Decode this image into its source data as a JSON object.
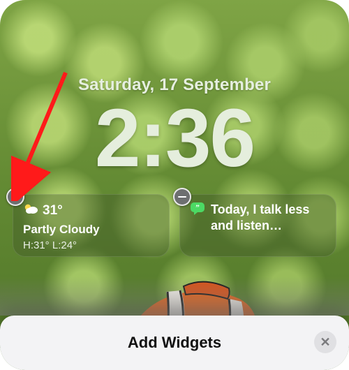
{
  "lockscreen": {
    "date": "Saturday, 17 September",
    "time": "2:36"
  },
  "widgets": {
    "weather": {
      "temp": "31°",
      "condition": "Partly Cloudy",
      "high_low": "H:31° L:24°",
      "icon_name": "partly-cloudy-icon"
    },
    "quote": {
      "text": "Today, I talk less and listen…",
      "icon_name": "quote-icon"
    }
  },
  "sheet": {
    "title": "Add Widgets"
  },
  "annotation": {
    "arrow_color": "#ff1a1a"
  }
}
